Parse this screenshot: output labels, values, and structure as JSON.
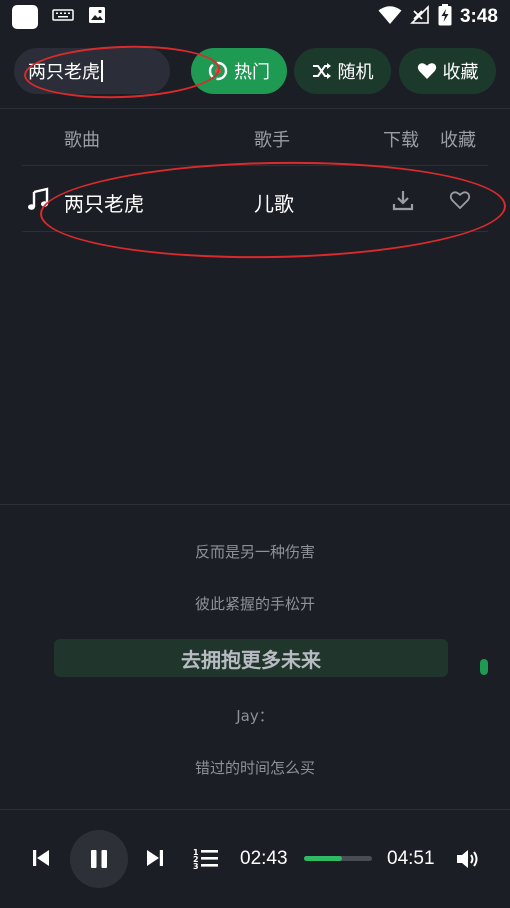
{
  "status_bar": {
    "time": "3:48",
    "icons": [
      "app-square-icon",
      "keyboard-icon",
      "image-icon",
      "wifi-icon",
      "no-signal-icon",
      "battery-charging-icon"
    ]
  },
  "search": {
    "value": "两只老虎"
  },
  "tags": {
    "hot": "热门",
    "random": "随机",
    "favorites": "收藏"
  },
  "table": {
    "headers": {
      "song": "歌曲",
      "artist": "歌手",
      "download": "下载",
      "favorite": "收藏"
    },
    "rows": [
      {
        "song": "两只老虎",
        "artist": "儿歌"
      }
    ]
  },
  "lyrics": {
    "lines": [
      "反而是另一种伤害",
      "彼此紧握的手松开",
      "去拥抱更多未来",
      "Jay：",
      "错过的时间怎么买"
    ],
    "active_index": 2
  },
  "player": {
    "current_time": "02:43",
    "total_time": "04:51",
    "progress": 0.56
  },
  "colors": {
    "accent": "#1f9a53",
    "background": "#1c1e26",
    "annotation": "#d92b2b"
  }
}
